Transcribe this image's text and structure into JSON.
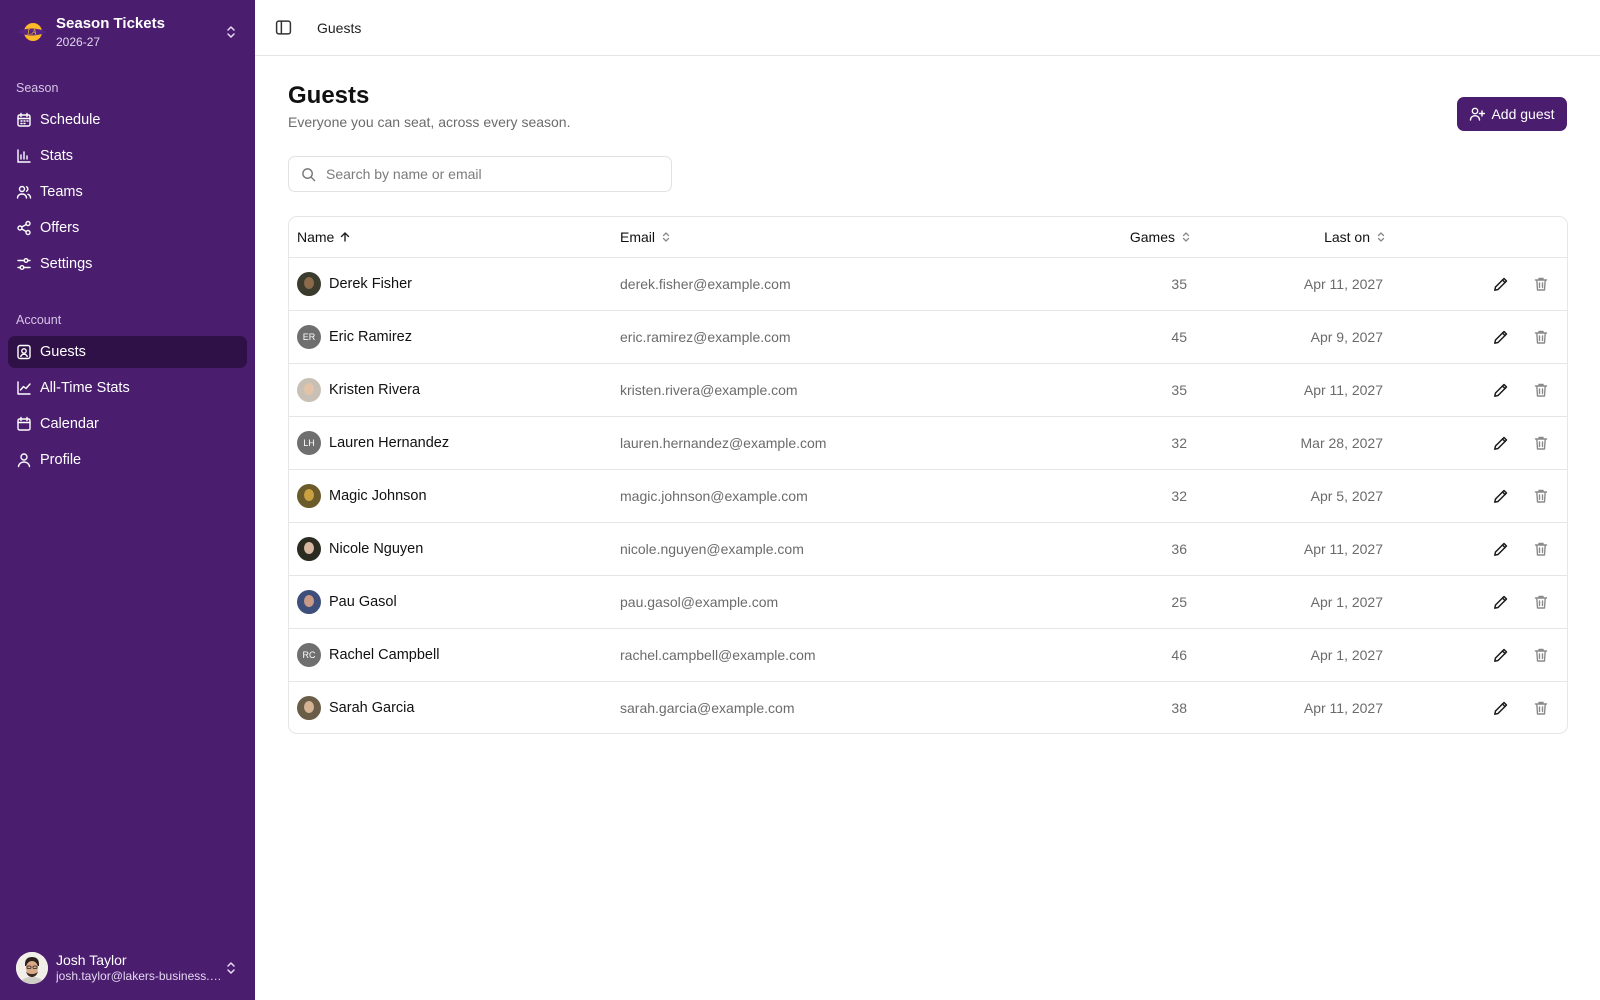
{
  "sidebar": {
    "team": {
      "title": "Season Tickets",
      "subtitle": "2026-27"
    },
    "sections": [
      {
        "label": "Season"
      },
      {
        "label": "Account"
      }
    ],
    "season_items": [
      {
        "label": "Schedule",
        "icon": "calendar-grid-icon"
      },
      {
        "label": "Stats",
        "icon": "bar-chart-icon"
      },
      {
        "label": "Teams",
        "icon": "users-icon"
      },
      {
        "label": "Offers",
        "icon": "share-icon"
      },
      {
        "label": "Settings",
        "icon": "sliders-icon"
      }
    ],
    "account_items": [
      {
        "label": "Guests",
        "icon": "contact-icon",
        "active": true
      },
      {
        "label": "All-Time Stats",
        "icon": "line-chart-icon"
      },
      {
        "label": "Calendar",
        "icon": "calendar-icon"
      },
      {
        "label": "Profile",
        "icon": "user-icon"
      }
    ],
    "user": {
      "name": "Josh Taylor",
      "email": "josh.taylor@lakers-business.com"
    }
  },
  "topbar": {
    "breadcrumb": "Guests"
  },
  "main": {
    "title": "Guests",
    "subtitle": "Everyone you can seat, across every season.",
    "add_button": "Add guest",
    "search_placeholder": "Search by name or email"
  },
  "table": {
    "columns": {
      "name": "Name",
      "email": "Email",
      "games": "Games",
      "last_on": "Last on"
    },
    "sort": {
      "column": "Name",
      "direction": "ascending"
    },
    "rows": [
      {
        "name": "Derek Fisher",
        "email": "derek.fisher@example.com",
        "games": "35",
        "last_on": "Apr 11, 2027",
        "avatar": "photo"
      },
      {
        "name": "Eric Ramirez",
        "email": "eric.ramirez@example.com",
        "games": "45",
        "last_on": "Apr 9, 2027",
        "avatar": "initials",
        "initials": "ER"
      },
      {
        "name": "Kristen Rivera",
        "email": "kristen.rivera@example.com",
        "games": "35",
        "last_on": "Apr 11, 2027",
        "avatar": "photo"
      },
      {
        "name": "Lauren Hernandez",
        "email": "lauren.hernandez@example.com",
        "games": "32",
        "last_on": "Mar 28, 2027",
        "avatar": "initials",
        "initials": "LH"
      },
      {
        "name": "Magic Johnson",
        "email": "magic.johnson@example.com",
        "games": "32",
        "last_on": "Apr 5, 2027",
        "avatar": "photo"
      },
      {
        "name": "Nicole Nguyen",
        "email": "nicole.nguyen@example.com",
        "games": "36",
        "last_on": "Apr 11, 2027",
        "avatar": "photo"
      },
      {
        "name": "Pau Gasol",
        "email": "pau.gasol@example.com",
        "games": "25",
        "last_on": "Apr 1, 2027",
        "avatar": "photo"
      },
      {
        "name": "Rachel Campbell",
        "email": "rachel.campbell@example.com",
        "games": "46",
        "last_on": "Apr 1, 2027",
        "avatar": "initials",
        "initials": "RC"
      },
      {
        "name": "Sarah Garcia",
        "email": "sarah.garcia@example.com",
        "games": "38",
        "last_on": "Apr 11, 2027",
        "avatar": "photo"
      }
    ]
  },
  "colors": {
    "sidebar_bg": "#4a1d6e",
    "sidebar_active": "#2f1047",
    "accent": "#4a1d6e",
    "logo_gold": "#fdb927"
  }
}
